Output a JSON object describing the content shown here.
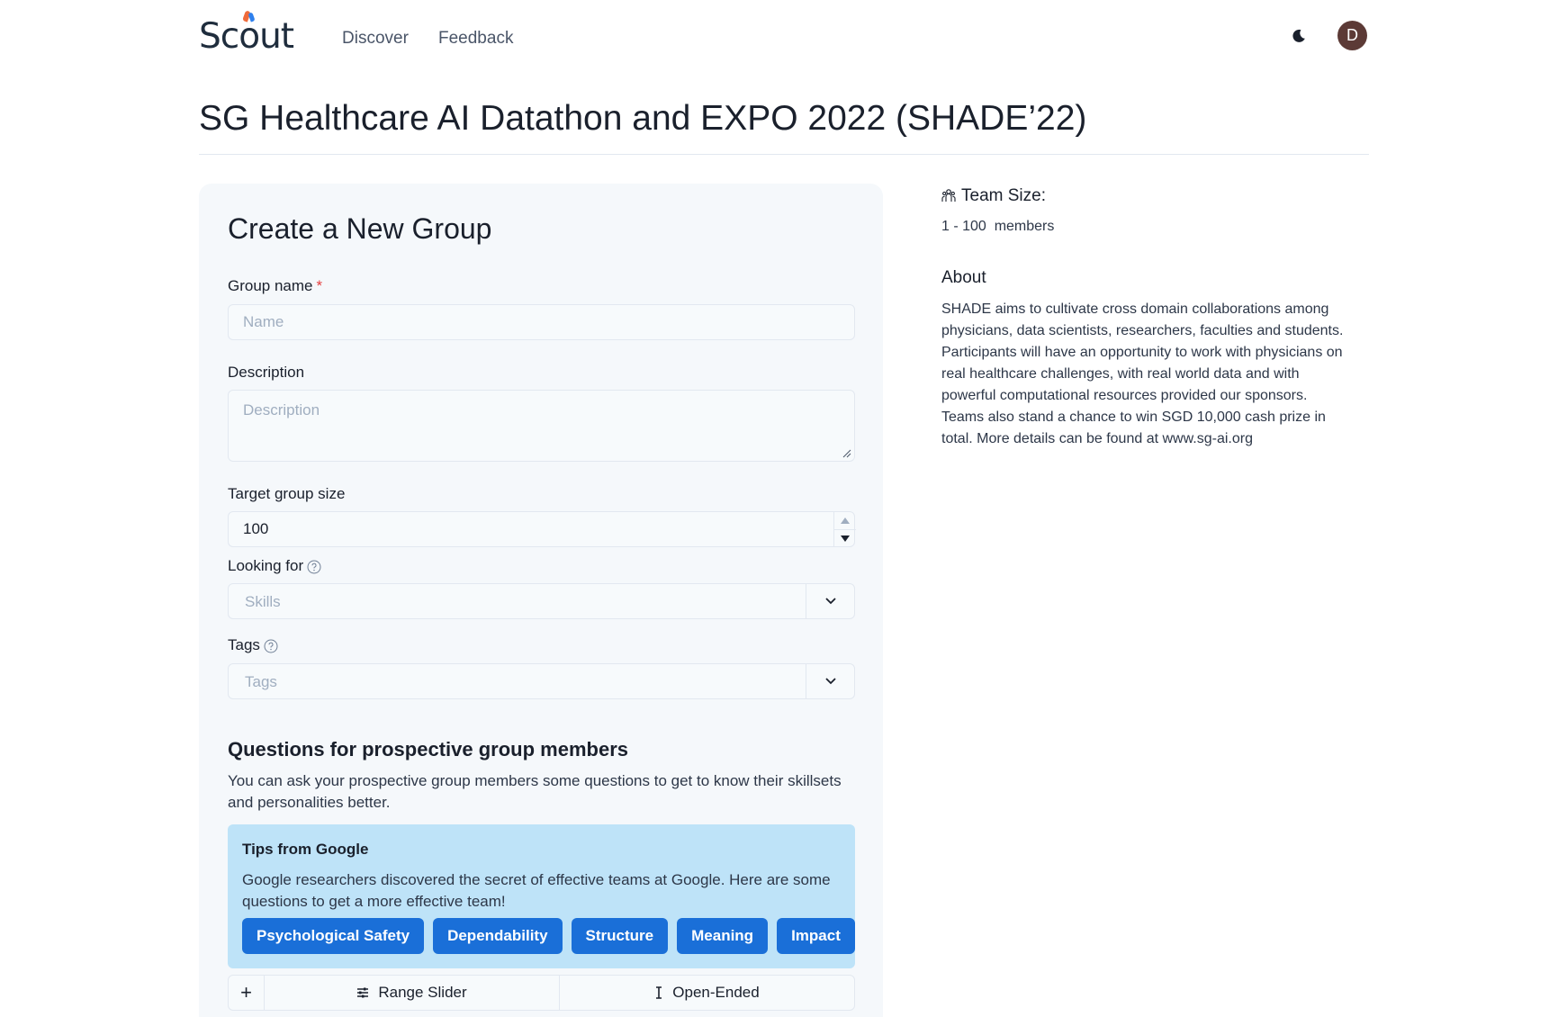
{
  "header": {
    "logo_text": "Scout",
    "nav": [
      {
        "label": "Discover"
      },
      {
        "label": "Feedback"
      }
    ],
    "theme_toggle_icon": "moon-icon",
    "avatar_initial": "D",
    "avatar_color": "#5c3a36"
  },
  "page": {
    "title": "SG Healthcare AI Datathon and EXPO 2022 (SHADE’22)"
  },
  "form": {
    "title": "Create a New Group",
    "group_name": {
      "label": "Group name",
      "required_mark": "*",
      "placeholder": "Name",
      "value": ""
    },
    "description": {
      "label": "Description",
      "placeholder": "Description",
      "value": ""
    },
    "target_group_size": {
      "label": "Target group size",
      "value": "100"
    },
    "looking_for": {
      "label": "Looking for",
      "placeholder": "Skills"
    },
    "tags": {
      "label": "Tags",
      "placeholder": "Tags"
    },
    "questions": {
      "title": "Questions for prospective group members",
      "description": "You can ask your prospective group members some questions to get to know their skillsets and personalities better."
    },
    "tips": {
      "title": "Tips from Google",
      "body": "Google researchers discovered the secret of effective teams at Google. Here are some questions to get a more effective team!",
      "buttons": [
        {
          "label": "Psychological Safety"
        },
        {
          "label": "Dependability"
        },
        {
          "label": "Structure"
        },
        {
          "label": "Meaning"
        },
        {
          "label": "Impact"
        }
      ]
    },
    "question_types": {
      "add_label": "+",
      "range_slider": "Range Slider",
      "open_ended": "Open-Ended"
    }
  },
  "side": {
    "team_size_label": "Team Size:",
    "team_size_value": "1 - 100  members",
    "about_label": "About",
    "about_text": "SHADE aims to cultivate cross domain collaborations among physicians, data scientists, researchers, faculties and students. Participants will have an opportunity to work with physicians on real healthcare challenges, with real world data and with powerful computational resources provided our sponsors. Teams also stand a chance to win SGD 10,000 cash prize in total. More details can be found at www.sg-ai.org"
  },
  "colors": {
    "primary_button": "#1a6fd8",
    "tips_background": "#bee3f8",
    "card_background": "#f5f8fb",
    "required": "#e53e3e"
  }
}
